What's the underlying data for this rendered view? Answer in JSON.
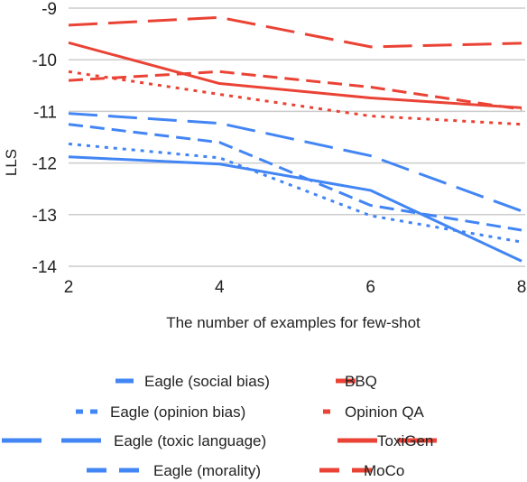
{
  "chart_data": {
    "type": "line",
    "title": "",
    "xlabel": "The number of examples for few-shot",
    "ylabel": "LLS",
    "x": [
      2,
      4,
      6,
      8
    ],
    "xticks": [
      "2",
      "4",
      "6",
      "8"
    ],
    "yticks": [
      "-9",
      "-10",
      "-11",
      "-12",
      "-13",
      "-14"
    ],
    "ylim": [
      -14,
      -9
    ],
    "xlim": [
      2,
      8
    ],
    "grid": true,
    "legend_position": "bottom",
    "series": [
      {
        "name": "Eagle (social bias)",
        "color": "#4285F4",
        "style": "solid",
        "legend_style": "short",
        "values": [
          -11.88,
          -12.02,
          -12.53,
          -13.9
        ]
      },
      {
        "name": "BBQ",
        "color": "#EA4335",
        "style": "dashed",
        "legend_style": "short",
        "values": [
          -10.4,
          -10.23,
          -10.53,
          -10.96
        ]
      },
      {
        "name": "Eagle (opinion bias)",
        "color": "#4285F4",
        "style": "dotted",
        "legend_style": "dotted",
        "values": [
          -11.63,
          -11.9,
          -13.02,
          -13.53
        ]
      },
      {
        "name": "Opinion QA",
        "color": "#EA4335",
        "style": "dotted",
        "legend_style": "dotted",
        "values": [
          -10.23,
          -10.67,
          -11.09,
          -11.25
        ]
      },
      {
        "name": "Eagle (toxic language)",
        "color": "#4285F4",
        "style": "longdash",
        "legend_style": "longdash",
        "values": [
          -11.04,
          -11.23,
          -11.86,
          -12.93
        ]
      },
      {
        "name": "ToxiGen",
        "color": "#EA4335",
        "style": "solid",
        "legend_style": "longdash",
        "values": [
          -9.67,
          -10.46,
          -10.74,
          -10.93
        ]
      },
      {
        "name": "Eagle (morality)",
        "color": "#4285F4",
        "style": "dashed",
        "legend_style": "dashed",
        "values": [
          -11.25,
          -11.6,
          -12.82,
          -13.3
        ]
      },
      {
        "name": "MoCo",
        "color": "#EA4335",
        "style": "longdash",
        "legend_style": "dashed",
        "values": [
          -9.33,
          -9.18,
          -9.75,
          -9.68
        ]
      }
    ]
  }
}
